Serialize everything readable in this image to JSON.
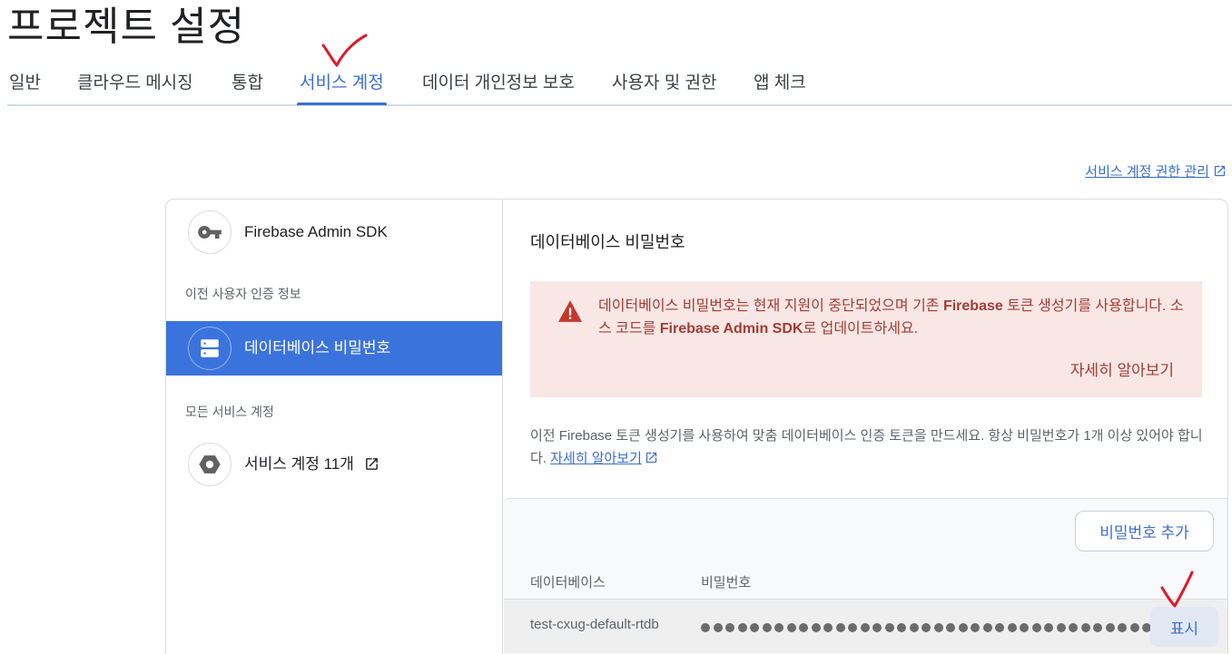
{
  "header": {
    "title": "프로젝트 설정"
  },
  "tabs": [
    {
      "label": "일반"
    },
    {
      "label": "클라우드 메시징"
    },
    {
      "label": "통합"
    },
    {
      "label": "서비스 계정"
    },
    {
      "label": "데이터 개인정보 보호"
    },
    {
      "label": "사용자 및 권한"
    },
    {
      "label": "앱 체크"
    }
  ],
  "active_tab": "서비스 계정",
  "permissions_link": {
    "label": "서비스 계정 권한 관리"
  },
  "sidebar": {
    "sdk_item": {
      "label": "Firebase Admin SDK",
      "icon": "key-icon"
    },
    "legacy_section": "이전 사용자 인증 정보",
    "db_item": {
      "label": "데이터베이스 비밀번호",
      "icon": "database-icon"
    },
    "all_section": "모든 서비스 계정",
    "accounts_item": {
      "label": "서비스 계정 11개",
      "icon": "hexagon-icon"
    }
  },
  "content": {
    "title": "데이터베이스 비밀번호",
    "alert": {
      "part1": "데이터베이스 비밀번호는 현재 지원이 중단되었으며 기존 ",
      "bold1": "Firebase",
      "part2": " 토큰 생성기를 사용합니다. 소스 코드를 ",
      "bold2": "Firebase Admin SDK",
      "part3": "로 업데이트하세요.",
      "learn_more": "자세히 알아보기"
    },
    "description": "이전 Firebase 토큰 생성기를 사용하여 맞춤 데이터베이스 인증 토큰을 만드세요. 항상 비밀번호가 1개 이상 있어야 합니다.",
    "description_link": "자세히 알아보기",
    "add_button": "비밀번호 추가",
    "table": {
      "headers": [
        "데이터베이스",
        "비밀번호"
      ],
      "rows": [
        {
          "database": "test-cxug-default-rtdb",
          "password_masked": "●●●●●●●●●●●●●●●●●●●●●●●●●●●●●●●●●●●●●●",
          "action": "표시"
        }
      ]
    }
  },
  "colors": {
    "accent": "#3b73dc",
    "link": "#3b6fd0",
    "alert_bg": "#f9e7e5",
    "alert_text": "#a53c32",
    "annotation": "#e0192a"
  }
}
